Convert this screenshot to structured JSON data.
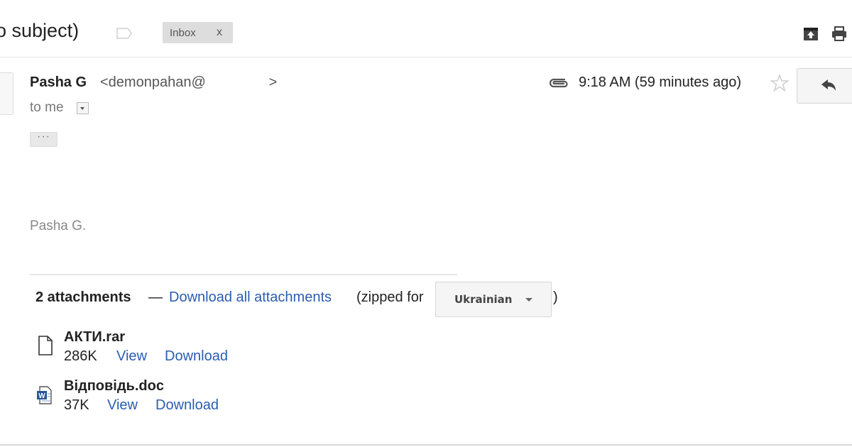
{
  "header": {
    "subject": "o subject)",
    "label": "Inbox",
    "label_remove": "x"
  },
  "message": {
    "sender_name": "Pasha G",
    "sender_email": "<demonpahan@                >",
    "recipient": "to me",
    "ellipsis": "···",
    "time": "9:18 AM (59 minutes ago)",
    "signature": "Pasha G."
  },
  "attachments": {
    "count_label": "2 attachments",
    "dash": "—",
    "download_all": "Download all attachments",
    "zipped_for": "(zipped for",
    "language": "Ukrainian",
    "close_paren": ")",
    "files": [
      {
        "name": "АКТИ.rar",
        "size": "286K",
        "view": "View",
        "download": "Download",
        "icon": "generic-file-icon"
      },
      {
        "name": "Відповідь.doc",
        "size": "37K",
        "view": "View",
        "download": "Download",
        "icon": "word-doc-icon"
      }
    ]
  },
  "colors": {
    "link": "#2a5db0",
    "label_bg": "#dddddd",
    "text": "#222222",
    "muted": "#888888"
  }
}
